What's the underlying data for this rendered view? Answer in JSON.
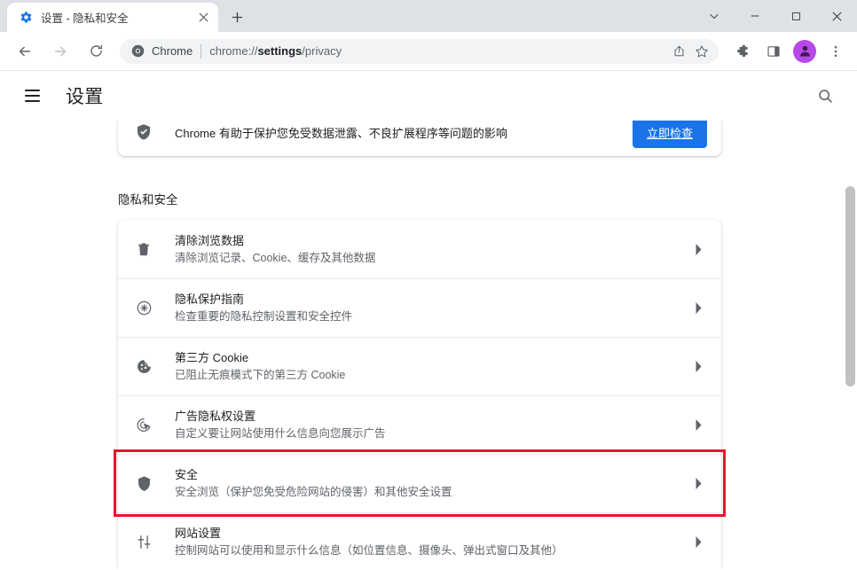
{
  "window": {
    "controls": [
      {
        "name": "tab-search",
        "glyph": "chevron-down-icon"
      },
      {
        "name": "minimize",
        "glyph": "minimize-icon"
      },
      {
        "name": "maximize",
        "glyph": "maximize-icon"
      },
      {
        "name": "close",
        "glyph": "close-icon"
      }
    ]
  },
  "tab": {
    "title": "设置 - 隐私和安全",
    "favicon": "gear-icon",
    "close_label": "×",
    "newtab_label": "+"
  },
  "toolbar": {
    "back": "back-arrow-icon",
    "forward": "forward-arrow-icon",
    "reload": "reload-icon",
    "omnibox": {
      "chip": "Chrome",
      "icon": "chrome-logo-icon",
      "url_prefix": "chrome://",
      "url_bold": "settings",
      "url_suffix": "/privacy",
      "share": "share-icon",
      "bookmark": "star-icon"
    },
    "extensions": "puzzle-icon",
    "side_panel": "side-panel-icon",
    "avatar": "profile-avatar",
    "menu": "three-dot-menu-icon"
  },
  "settings_header": {
    "menu_label": "hamburger-icon",
    "title": "设置",
    "search": "search-icon"
  },
  "safety_check": {
    "icon": "shield-check-icon",
    "text": "Chrome 有助于保护您免受数据泄露、不良扩展程序等问题的影响",
    "button_label": "立即检查",
    "button_color": "#1a73e8"
  },
  "privacy_section": {
    "heading": "隐私和安全",
    "highlight_color": "#e8152a",
    "rows": [
      {
        "icon": "trash-icon",
        "title": "清除浏览数据",
        "subtitle": "清除浏览记录、Cookie、缓存及其他数据",
        "chevron": "chevron-right-icon",
        "highlighted": false
      },
      {
        "icon": "privacy-guide-icon",
        "title": "隐私保护指南",
        "subtitle": "检查重要的隐私控制设置和安全控件",
        "chevron": "chevron-right-icon",
        "highlighted": false
      },
      {
        "icon": "cookie-icon",
        "title": "第三方 Cookie",
        "subtitle": "已阻止无痕模式下的第三方 Cookie",
        "chevron": "chevron-right-icon",
        "highlighted": false
      },
      {
        "icon": "ad-privacy-icon",
        "title": "广告隐私权设置",
        "subtitle": "自定义要让网站使用什么信息向您展示广告",
        "chevron": "chevron-right-icon",
        "highlighted": false
      },
      {
        "icon": "shield-icon",
        "title": "安全",
        "subtitle": "安全浏览（保护您免受危险网站的侵害）和其他安全设置",
        "chevron": "chevron-right-icon",
        "highlighted": true
      },
      {
        "icon": "tune-icon",
        "title": "网站设置",
        "subtitle": "控制网站可以使用和显示什么信息（如位置信息、摄像头、弹出式窗口及其他）",
        "chevron": "chevron-right-icon",
        "highlighted": false
      }
    ]
  }
}
